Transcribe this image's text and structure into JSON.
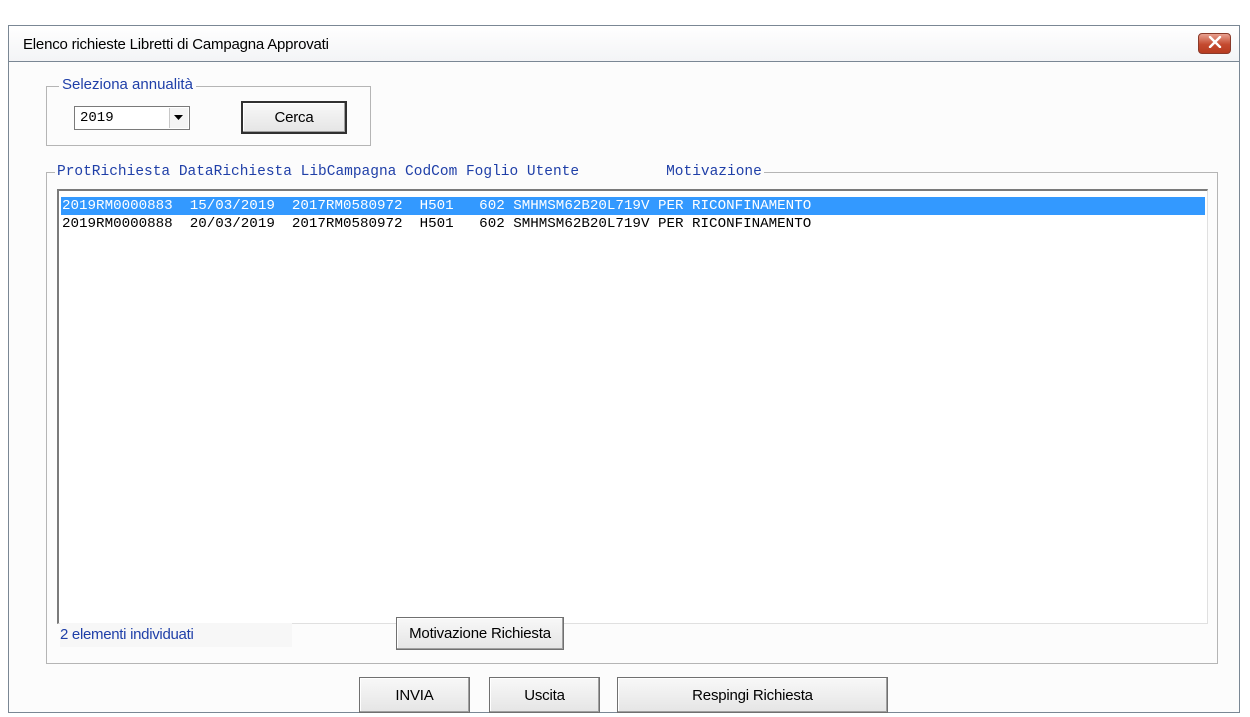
{
  "window": {
    "title": "Elenco richieste Libretti di Campagna Approvati"
  },
  "filter": {
    "legend": "Seleziona annualità",
    "year_value": "2019",
    "search_label": "Cerca"
  },
  "list": {
    "header": "ProtRichiesta DataRichiesta LibCampagna CodCom Foglio Utente          Motivazione",
    "columns": [
      "ProtRichiesta",
      "DataRichiesta",
      "LibCampagna",
      "CodCom",
      "Foglio",
      "Utente",
      "Motivazione"
    ],
    "rows": [
      {
        "text": "2019RM0000883  15/03/2019  2017RM0580972  H501   602 SMHMSM62B20L719V PER RICONFINAMENTO",
        "cells": [
          "2019RM0000883",
          "15/03/2019",
          "2017RM0580972",
          "H501",
          "602",
          "SMHMSM62B20L719V",
          "PER RICONFINAMENTO"
        ],
        "selected": true
      },
      {
        "text": "2019RM0000888  20/03/2019  2017RM0580972  H501   602 SMHMSM62B20L719V PER RICONFINAMENTO",
        "cells": [
          "2019RM0000888",
          "20/03/2019",
          "2017RM0580972",
          "H501",
          "602",
          "SMHMSM62B20L719V",
          "PER RICONFINAMENTO"
        ],
        "selected": false
      }
    ],
    "count_label": "2 elementi individuati",
    "reason_button": "Motivazione Richiesta"
  },
  "actions": {
    "send": "INVIA",
    "exit": "Uscita",
    "reject": "Respingi Richiesta"
  },
  "colors": {
    "legend_text": "#1f3fa8",
    "selection": "#3399ff",
    "close_button": "#c44a2f"
  }
}
